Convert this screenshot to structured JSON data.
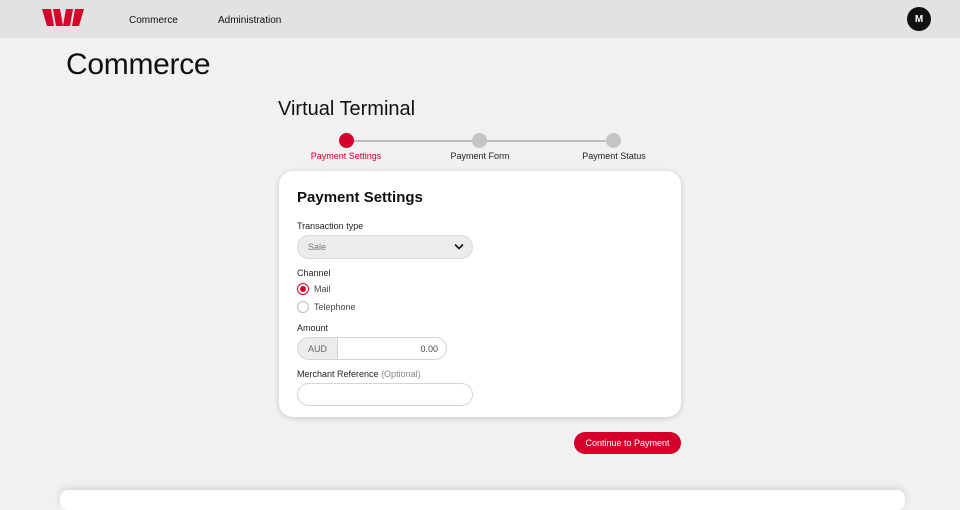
{
  "nav": {
    "items": [
      {
        "label": "Commerce"
      },
      {
        "label": "Administration"
      }
    ],
    "avatar_initial": "M"
  },
  "page": {
    "title": "Commerce",
    "section_title": "Virtual Terminal"
  },
  "stepper": {
    "steps": [
      {
        "label": "Payment Settings",
        "active": true
      },
      {
        "label": "Payment Form",
        "active": false
      },
      {
        "label": "Payment Status",
        "active": false
      }
    ]
  },
  "card": {
    "title": "Payment Settings",
    "transaction_type": {
      "label": "Transaction type",
      "selected": "Sale"
    },
    "channel": {
      "label": "Channel",
      "options": [
        {
          "label": "Mail",
          "checked": true
        },
        {
          "label": "Telephone",
          "checked": false
        }
      ]
    },
    "amount": {
      "label": "Amount",
      "currency": "AUD",
      "value": "0.00"
    },
    "merchant_reference": {
      "label": "Merchant Reference",
      "optional_note": "(Optional)",
      "value": ""
    }
  },
  "actions": {
    "continue_label": "Continue to Payment"
  },
  "colors": {
    "brand": "#d5002b",
    "topbar": "#e2e2e2",
    "background": "#f1f1f1"
  },
  "icons": {
    "logo": "westpac-logo-icon",
    "select": "chevron-down-icon"
  }
}
